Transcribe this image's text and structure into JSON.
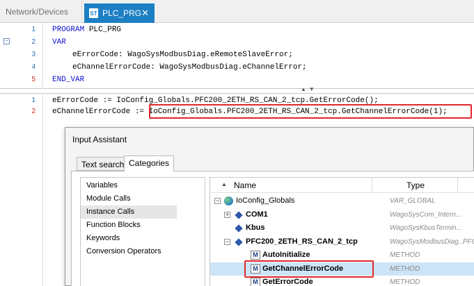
{
  "tabs": [
    {
      "label": "Network/Devices",
      "active": false
    },
    {
      "label": "PLC_PRG",
      "active": true,
      "icon": "st-icon",
      "close": "✕"
    }
  ],
  "declaration": {
    "line_numbers": [
      "1",
      "2",
      "3",
      "4",
      "5"
    ],
    "lines": [
      {
        "kw": "PROGRAM",
        "rest": " PLC_PRG"
      },
      {
        "kw": "VAR",
        "rest": ""
      },
      {
        "kw": "",
        "rest": "eErrorCode: WagoSysModbusDiag.eRemoteSlaveError;"
      },
      {
        "kw": "",
        "rest": "eChannelErrorCode: WagoSysModbusDiag.eChannelError;"
      },
      {
        "kw": "END_VAR",
        "rest": ""
      }
    ],
    "fold_symbol": "⊟"
  },
  "implementation": {
    "line_numbers": [
      "1",
      "2"
    ],
    "lines": [
      "eErrorCode := IoConfig_Globals.PFC200_2ETH_RS_CAN_2_tcp.GetErrorCode();",
      "eChannelErrorCode := IoConfig_Globals.PFC200_2ETH_RS_CAN_2_tcp.GetChannelErrorCode(1);"
    ]
  },
  "splitter_arrows": "▲▼",
  "input_assistant": {
    "title": "Input Assistant",
    "tabs": [
      "Text search",
      "Categories"
    ],
    "active_tab": "Categories",
    "categories": [
      "Variables",
      "Module Calls",
      "Instance Calls",
      "Function Blocks",
      "Keywords",
      "Conversion Operators"
    ],
    "selected_category": "Instance Calls",
    "columns": {
      "name": "Name",
      "type": "Type",
      "sort_icon": "▲"
    },
    "tree": [
      {
        "label": "IoConfig_Globals",
        "type": "VAR_GLOBAL",
        "expander": "−",
        "icon": "globe-icon"
      },
      {
        "label": "COM1",
        "type": "WagoSysCom_Intern...",
        "expander": "+",
        "icon": "diamond-icon"
      },
      {
        "label": "Kbus",
        "type": "WagoSysKbusTermin...",
        "expander": "",
        "icon": "diamond-icon"
      },
      {
        "label": "PFC200_2ETH_RS_CAN_2_tcp",
        "type": "WagoSysModbusDiag...",
        "extra": "PFC",
        "expander": "−",
        "icon": "diamond-icon"
      },
      {
        "label": "AutoInitialize",
        "type": "METHOD",
        "expander": "",
        "icon": "method-icon"
      },
      {
        "label": "GetChannelErrorCode",
        "type": "METHOD",
        "expander": "",
        "icon": "method-icon"
      },
      {
        "label": "GetErrorCode",
        "type": "METHOD",
        "expander": "",
        "icon": "method-icon"
      }
    ],
    "selected_item": "GetChannelErrorCode",
    "method_icon_letter": "M"
  },
  "accent_colors": {
    "tab_active": "#1c7fc4",
    "highlight": "#e0262b",
    "selection": "#cce4f7"
  }
}
